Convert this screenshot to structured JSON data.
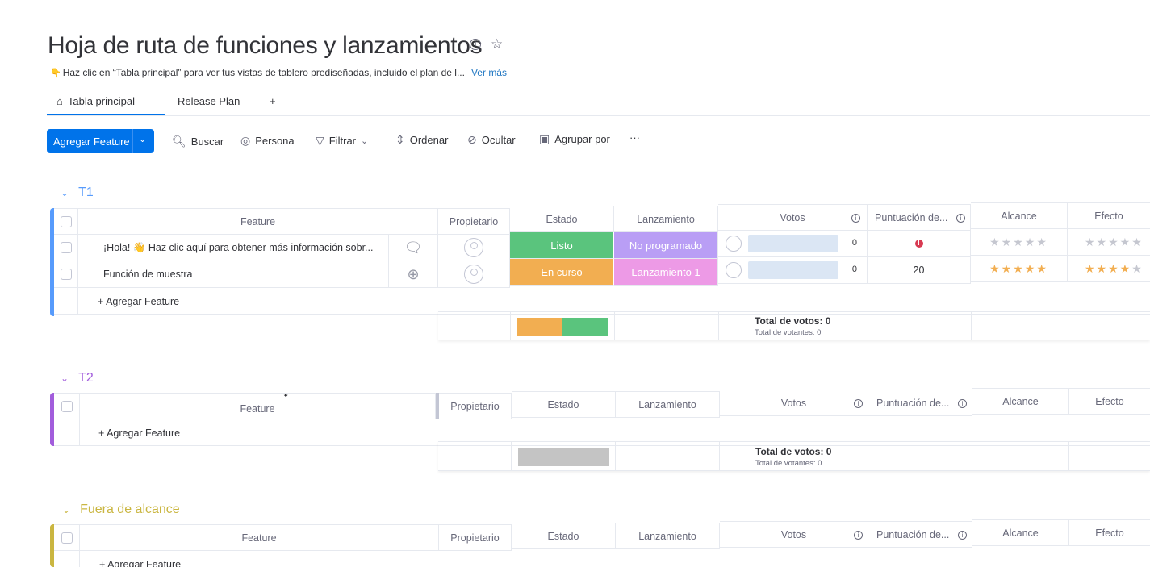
{
  "board": {
    "title": "Hoja de ruta de funciones y lanzamientos",
    "subtitle": "Haz clic en “Tabla principal” para ver tus vistas de tablero prediseñadas, incluido el plan de l...",
    "see_more": "Ver más"
  },
  "tabs": [
    {
      "label": "Tabla principal",
      "icon": "home-icon",
      "active": true
    },
    {
      "label": "Release Plan"
    },
    {
      "label": "+"
    }
  ],
  "toolbar": {
    "primary": "Agregar Feature",
    "search": "Buscar",
    "person": "Persona",
    "filter": "Filtrar",
    "sort": "Ordenar",
    "hide": "Ocultar",
    "group_by": "Agrupar por",
    "more": "···"
  },
  "columns": {
    "feature": "Feature",
    "owner": "Propietario",
    "status": "Estado",
    "launch": "Lanzamiento",
    "votes": "Votos",
    "score": "Puntuación de...",
    "reach": "Alcance",
    "effect": "Efecto"
  },
  "groups": [
    {
      "name": "T1",
      "color": "#579bfc",
      "rows": [
        {
          "feature": "¡Hola! 👋 Haz clic aquí para obtener más información sobr...",
          "status": "Listo",
          "status_color": "#5ac47d",
          "launch": "No programado",
          "launch_color": "#b99ef5",
          "votes": "0",
          "score": "!",
          "reach_stars": 0,
          "effect_stars": 0
        },
        {
          "feature": "Función de muestra",
          "status": "En curso",
          "status_color": "#f2ae51",
          "launch": "Lanzamiento 1",
          "launch_color": "#ed9ae6",
          "votes": "0",
          "score": "20",
          "reach_stars": 5,
          "effect_stars": 4
        }
      ],
      "add_label": "+ Agregar Feature",
      "total_votes": "Total de votos: 0",
      "total_voters": "Total de votantes: 0"
    },
    {
      "name": "T2",
      "color": "#a25ddc",
      "rows": [],
      "add_label": "+ Agregar Feature",
      "total_votes": "Total de votos: 0",
      "total_voters": "Total de votantes: 0"
    },
    {
      "name": "Fuera de alcance",
      "color": "#cab641",
      "rows": [],
      "add_label": "+ Agregar Feature"
    }
  ]
}
